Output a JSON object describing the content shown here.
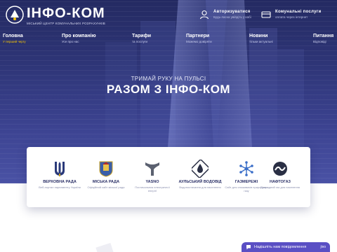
{
  "brand": {
    "title": "ІНФО-КОМ",
    "subtitle": "МІСЬКИЙ ЦЕНТР КОМУНАЛЬНИХ РОЗРАХУНКІВ"
  },
  "header": {
    "auth": {
      "title": "Авторизуватися",
      "subtitle": "Будь-ласка увійдіть у кабі"
    },
    "utilities": {
      "title": "Комунальні послуги",
      "subtitle": "оплата через інтернет"
    }
  },
  "nav": [
    {
      "label": "Головна",
      "sub": "У перший чергу"
    },
    {
      "label": "Про компанію",
      "sub": "Усе про нас"
    },
    {
      "label": "Тарифи",
      "sub": "та послуги"
    },
    {
      "label": "Партнери",
      "sub": "Можемо довіряти"
    },
    {
      "label": "Новини",
      "sub": "тільки актуальні"
    },
    {
      "label": "Питання",
      "sub": "Відповіді"
    }
  ],
  "hero": {
    "tagline": "ТРИМАЙ РУКУ НА ПУЛЬСІ",
    "headline": "РАЗОМ З ІНФО-КОМ"
  },
  "partners": [
    {
      "name": "ВЕРХОВНА РАДА",
      "desc": "Веб-портал парламенту України",
      "icon": "trident-icon"
    },
    {
      "name": "МІСЬКА РАДА",
      "desc": "Офіційний сайт міської ради",
      "icon": "city-coat-icon"
    },
    {
      "name": "YASNO",
      "desc": "Постачальник електричної енергії",
      "icon": "yasno-icon"
    },
    {
      "name": "АУЛЬСЬКИЙ ВОДОВІД",
      "desc": "Водопостачання для населення",
      "icon": "water-drop-icon"
    },
    {
      "name": "ГАЗМЕРЕЖІ",
      "desc": "Сайт для споживачів природного газу",
      "icon": "gas-network-icon"
    },
    {
      "name": "НАФТОГАЗ",
      "desc": "Природний газ для населення",
      "icon": "naftogaz-icon"
    }
  ],
  "chat": {
    "label": "Надішліть нам повідомлення",
    "badge": "jivo"
  },
  "colors": {
    "hero_dark": "#242a62",
    "accent_yellow": "#f5c400",
    "partner_text": "#2a2f66",
    "chat_bg": "#5a4fc4"
  }
}
